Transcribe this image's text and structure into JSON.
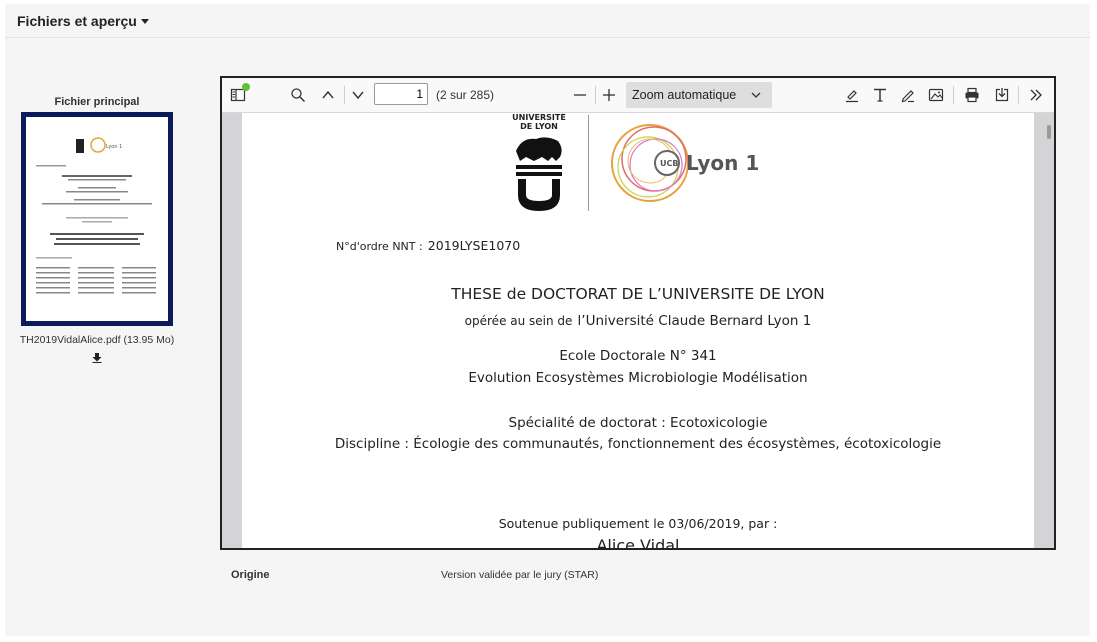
{
  "section": {
    "title": "Fichiers et aperçu"
  },
  "thumbnail": {
    "label": "Fichier principal",
    "filename": "TH2019VidalAlice.pdf (13.95 Mo)",
    "mini_title": "Approche toxicocinétique de la bioaccumulation des composés perfluoroalkylés chez la truite arc-en-ciel (Oncorhynchus mykiss)",
    "mini_logo": "Lyon 1"
  },
  "viewer": {
    "page_number": "1",
    "page_count": "(2 sur 285)",
    "zoom": "Zoom automatique",
    "icons": {
      "sidebar": "sidebar-toggle-icon",
      "find": "search-icon",
      "prev": "chevron-up-icon",
      "next": "chevron-down-icon",
      "zoom_out": "minus-icon",
      "zoom_in": "plus-icon",
      "highlight": "highlight-icon",
      "text": "text-icon",
      "draw": "pen-icon",
      "image": "image-icon",
      "print": "print-icon",
      "save": "download-icon",
      "more": "double-chevron-right-icon"
    },
    "colors": {
      "notification_dot": "#5cc23c",
      "thumb_border": "#0b1a5b"
    }
  },
  "document": {
    "univ_logo_top": "UNIVERSITÉ",
    "univ_logo_bottom": "DE LYON",
    "lyon1_logo": "Lyon 1",
    "ucb_logo": "UCB",
    "nnt_label": "N°d'ordre NNT :",
    "nnt_value": "2019LYSE1070",
    "line1": "THESE de DOCTORAT DE L’UNIVERSITE DE LYON",
    "line2_a": "opérée au sein de",
    "line2_b": "l’Université Claude Bernard Lyon 1",
    "line3": "Ecole Doctorale N° 341",
    "line4": "Evolution Ecosystèmes Microbiologie Modélisation",
    "line5": "Spécialité de doctorat : Ecotoxicologie",
    "line6": "Discipline : Écologie des communautés, fonctionnement des écosystèmes, écotoxicologie",
    "line7": "Soutenue publiquement le 03/06/2019, par :",
    "line8": "Alice Vidal"
  },
  "meta": {
    "origin_label": "Origine",
    "origin_value": "Version validée par le jury (STAR)"
  }
}
